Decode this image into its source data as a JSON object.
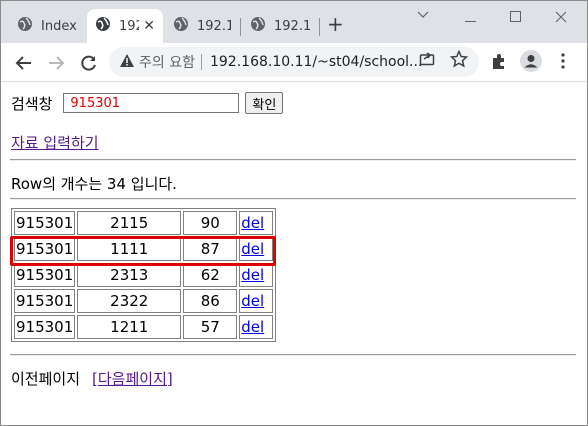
{
  "browser": {
    "tabs": [
      {
        "title": "Index",
        "active": false
      },
      {
        "title": "192",
        "active": true
      },
      {
        "title": "192.16",
        "active": false
      },
      {
        "title": "192.16",
        "active": false
      }
    ],
    "new_tab_symbol": "+",
    "address": {
      "security_text": "주의 요함",
      "url": "192.168.10.11/~st04/school..."
    },
    "icons": [
      "back-icon",
      "forward-icon",
      "reload-icon",
      "warning-icon",
      "share-icon",
      "bookmark-star-icon",
      "extensions-icon",
      "profile-icon",
      "menu-icon"
    ]
  },
  "page": {
    "search": {
      "label": "검색창",
      "value": "915301",
      "button": "확인"
    },
    "input_link": "자료 입력하기",
    "row_count_text": "Row의 개수는 34 입니다.",
    "table": {
      "rows": [
        [
          "915301",
          "2115",
          "90",
          "del"
        ],
        [
          "915301",
          "1111",
          "87",
          "del"
        ],
        [
          "915301",
          "2313",
          "62",
          "del"
        ],
        [
          "915301",
          "2322",
          "86",
          "del"
        ],
        [
          "915301",
          "1211",
          "57",
          "del"
        ]
      ],
      "highlighted_row": 1,
      "highlight_color": "#e00000"
    },
    "pager": {
      "prev": "이전페이지",
      "next": "[다음페이지]"
    }
  }
}
